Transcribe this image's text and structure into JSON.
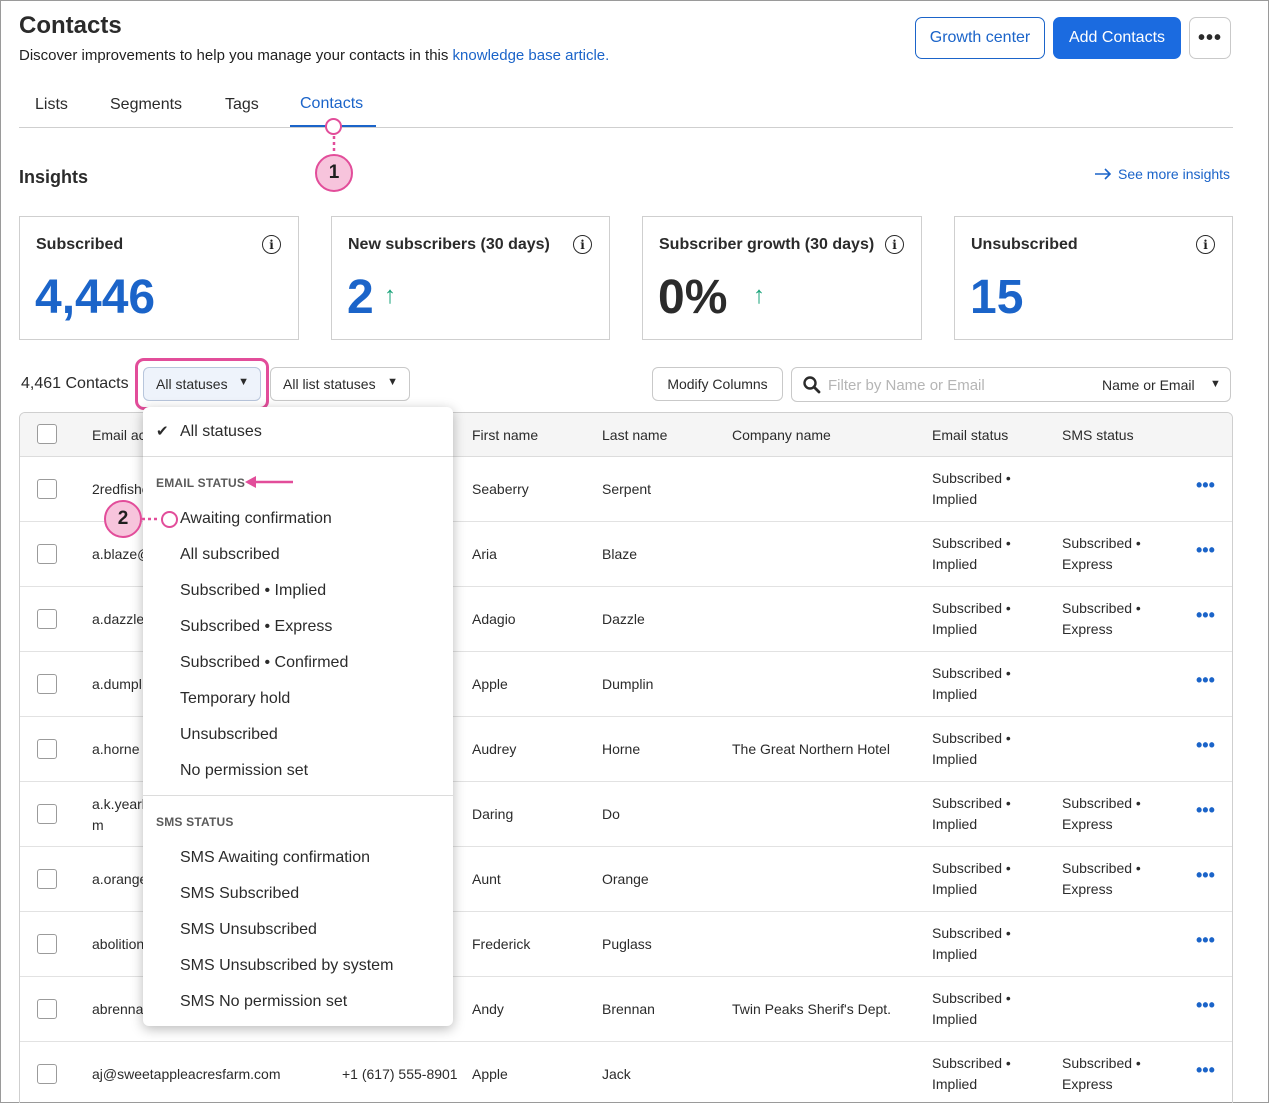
{
  "header": {
    "title": "Contacts",
    "subtitle_prefix": "Discover improvements to help you manage your contacts in this ",
    "subtitle_link": "knowledge base article.",
    "growth_center_label": "Growth center",
    "add_contacts_label": "Add Contacts",
    "more_label": "•••"
  },
  "tabs": [
    {
      "label": "Lists",
      "active": false
    },
    {
      "label": "Segments",
      "active": false
    },
    {
      "label": "Tags",
      "active": false
    },
    {
      "label": "Contacts",
      "active": true
    }
  ],
  "insights": {
    "title": "Insights",
    "see_more": "See more insights",
    "cards": [
      {
        "label": "Subscribed",
        "value": "4,446",
        "trend": ""
      },
      {
        "label": "New subscribers (30 days)",
        "value": "2",
        "trend": "↑"
      },
      {
        "label": "Subscriber growth (30 days)",
        "value": "0%",
        "trend": "↑"
      },
      {
        "label": "Unsubscribed",
        "value": "15",
        "trend": ""
      }
    ]
  },
  "toolbar": {
    "count": "4,461 Contacts",
    "status_filter": "All statuses",
    "list_status_filter": "All list statuses",
    "modify_columns": "Modify Columns",
    "search_placeholder": "Filter by Name or Email",
    "search_scope": "Name or Email"
  },
  "table": {
    "columns": [
      "Email ac",
      "First name",
      "Last name",
      "Company name",
      "Email status",
      "SMS status"
    ],
    "rows": [
      {
        "email": "2redfishe",
        "phone": "",
        "first": "Seaberry",
        "last": "Serpent",
        "company": "",
        "email_status": [
          "Subscribed •",
          "Implied"
        ],
        "sms_status": [
          "",
          ""
        ]
      },
      {
        "email": "a.blaze@",
        "phone": "",
        "first": "Aria",
        "last": "Blaze",
        "company": "",
        "email_status": [
          "Subscribed •",
          "Implied"
        ],
        "sms_status": [
          "Subscribed •",
          "Express"
        ]
      },
      {
        "email": "a.dazzle",
        "phone": "",
        "first": "Adagio",
        "last": "Dazzle",
        "company": "",
        "email_status": [
          "Subscribed •",
          "Implied"
        ],
        "sms_status": [
          "Subscribed •",
          "Express"
        ]
      },
      {
        "email": "a.dumpl",
        "phone": "",
        "first": "Apple",
        "last": "Dumplin",
        "company": "",
        "email_status": [
          "Subscribed •",
          "Implied"
        ],
        "sms_status": [
          "",
          ""
        ]
      },
      {
        "email": "a.horne",
        "phone": "",
        "first": "Audrey",
        "last": "Horne",
        "company": "The Great Northern Hotel",
        "email_status": [
          "Subscribed •",
          "Implied"
        ],
        "sms_status": [
          "",
          ""
        ]
      },
      {
        "email": "a.k.yearl",
        "email2": "m",
        "phone": "",
        "first": "Daring",
        "last": "Do",
        "company": "",
        "email_status": [
          "Subscribed •",
          "Implied"
        ],
        "sms_status": [
          "Subscribed •",
          "Express"
        ]
      },
      {
        "email": "a.orange",
        "phone": "",
        "first": "Aunt",
        "last": "Orange",
        "company": "",
        "email_status": [
          "Subscribed •",
          "Implied"
        ],
        "sms_status": [
          "Subscribed •",
          "Express"
        ]
      },
      {
        "email": "abolition",
        "phone": "",
        "first": "Frederick",
        "last": "Puglass",
        "company": "",
        "email_status": [
          "Subscribed •",
          "Implied"
        ],
        "sms_status": [
          "",
          ""
        ]
      },
      {
        "email": "abrenna",
        "phone": "",
        "first": "Andy",
        "last": "Brennan",
        "company": "Twin Peaks Sherif's Dept.",
        "email_status": [
          "Subscribed •",
          "Implied"
        ],
        "sms_status": [
          "",
          ""
        ]
      },
      {
        "email": "aj@sweetappleacresfarm.com",
        "phone": "+1 (617) 555-8901",
        "first": "Apple",
        "last": "Jack",
        "company": "",
        "email_status": [
          "Subscribed •",
          "Implied"
        ],
        "sms_status": [
          "Subscribed •",
          "Express"
        ]
      }
    ]
  },
  "status_menu": {
    "all": "All statuses",
    "email_section": "EMAIL STATUS",
    "email_items": [
      "Awaiting confirmation",
      "All subscribed",
      "Subscribed • Implied",
      "Subscribed • Express",
      "Subscribed • Confirmed",
      "Temporary hold",
      "Unsubscribed",
      "No permission set"
    ],
    "sms_section": "SMS STATUS",
    "sms_items": [
      "SMS Awaiting confirmation",
      "SMS Subscribed",
      "SMS Unsubscribed",
      "SMS Unsubscribed by system",
      "SMS No permission set"
    ]
  },
  "annotations": {
    "callout_1": "1",
    "callout_2": "2"
  },
  "colors": {
    "accent": "#1b64c9",
    "primary_button": "#1b6be0",
    "highlight": "#e24d9a",
    "trend_up": "#1aa37a"
  }
}
